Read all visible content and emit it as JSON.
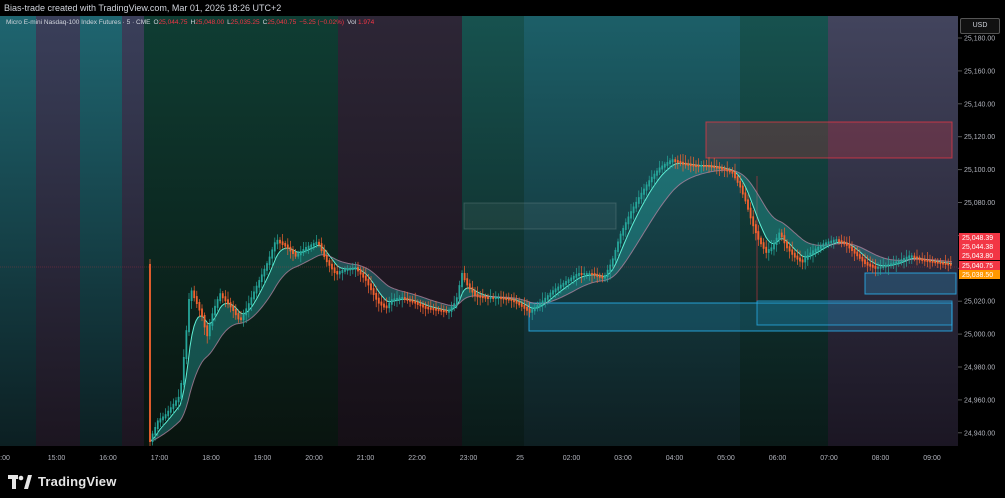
{
  "header": {
    "caption": "Bias-trade created with TradingView.com, Mar 01, 2026 18:26 UTC+2"
  },
  "legend": {
    "symbol": "Micro E-mini Nasdaq-100 Index Futures · 5 · CME",
    "open_label": "O",
    "open": "25,044.75",
    "high_label": "H",
    "high": "25,048.00",
    "low_label": "L",
    "low": "25,035.25",
    "close_label": "C",
    "close": "25,040.75",
    "change": "−5.25 (−0.02%)",
    "vol_label": "Vol",
    "vol": "1.974"
  },
  "price_axis": {
    "currency": "USD",
    "ticks": [
      "25,180.00",
      "25,160.00",
      "25,140.00",
      "25,120.00",
      "25,100.00",
      "25,080.00",
      "25,060.00",
      "25,040.00",
      "25,020.00",
      "25,000.00",
      "24,980.00",
      "24,960.00",
      "24,940.00"
    ],
    "price_labels": [
      {
        "text": "25,048.39",
        "color": "#f23645"
      },
      {
        "text": "25,044.38",
        "color": "#f23645"
      },
      {
        "text": "25,043.80",
        "color": "#f23645"
      },
      {
        "text": "25,040.75",
        "color": "#f23645"
      },
      {
        "text": "25,038.50",
        "color": "#ff9800"
      }
    ]
  },
  "time_axis": {
    "ticks": [
      ":00",
      "15:00",
      "16:00",
      "17:00",
      "18:00",
      "19:00",
      "20:00",
      "21:00",
      "22:00",
      "23:00",
      "25",
      "02:00",
      "03:00",
      "04:00",
      "05:00",
      "06:00",
      "07:00",
      "08:00",
      "09:00"
    ]
  },
  "colors": {
    "up": "#26a69a",
    "down": "#f5632f",
    "ribbon_up": "#2bb7b5",
    "ribbon_down": "#c08aa8",
    "supply_zone": "#f23645",
    "demand_zone": "#29b6f6"
  },
  "footer": {
    "brand": "TradingView"
  }
}
